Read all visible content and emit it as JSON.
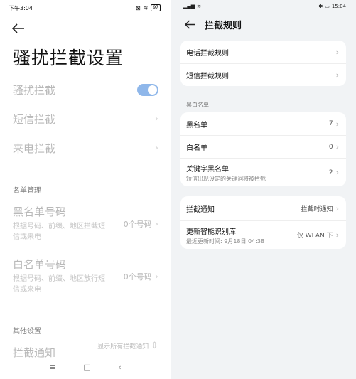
{
  "left": {
    "status": {
      "time": "下午3:04",
      "battery": "97"
    },
    "title": "骚扰拦截设置",
    "rows": {
      "harass": "骚扰拦截",
      "sms": "短信拦截",
      "call": "来电拦截"
    },
    "section_lists": "名单管理",
    "blacklist": {
      "title": "黑名单号码",
      "subtitle": "根据号码、前缀、地区拦截短信或来电",
      "value": "0个号码"
    },
    "whitelist": {
      "title": "白名单号码",
      "subtitle": "根据号码、前缀、地区放行短信或来电",
      "value": "0个号码"
    },
    "section_other": "其他设置",
    "notify": {
      "title": "拦截通知",
      "value": "显示所有拦截通知"
    }
  },
  "right": {
    "status": {
      "time": "15:04"
    },
    "title": "拦截规则",
    "rules": [
      {
        "label": "电话拦截规则"
      },
      {
        "label": "短信拦截规则"
      }
    ],
    "section": "黑白名单",
    "lists": [
      {
        "label": "黑名单",
        "value": "7"
      },
      {
        "label": "白名单",
        "value": "0"
      },
      {
        "label": "关键字黑名单",
        "sub": "短信出现设定的关键词将被拦截",
        "value": "2"
      }
    ],
    "settings": [
      {
        "label": "拦截通知",
        "value": "拦截时通知"
      },
      {
        "label": "更新智能识别库",
        "sub": "最近更新时间: 9月18日 04:38",
        "value": "仅 WLAN 下"
      }
    ]
  },
  "colors": {
    "toggle_on": "#8fb7ea",
    "right_bg": "#f1f3f5"
  }
}
